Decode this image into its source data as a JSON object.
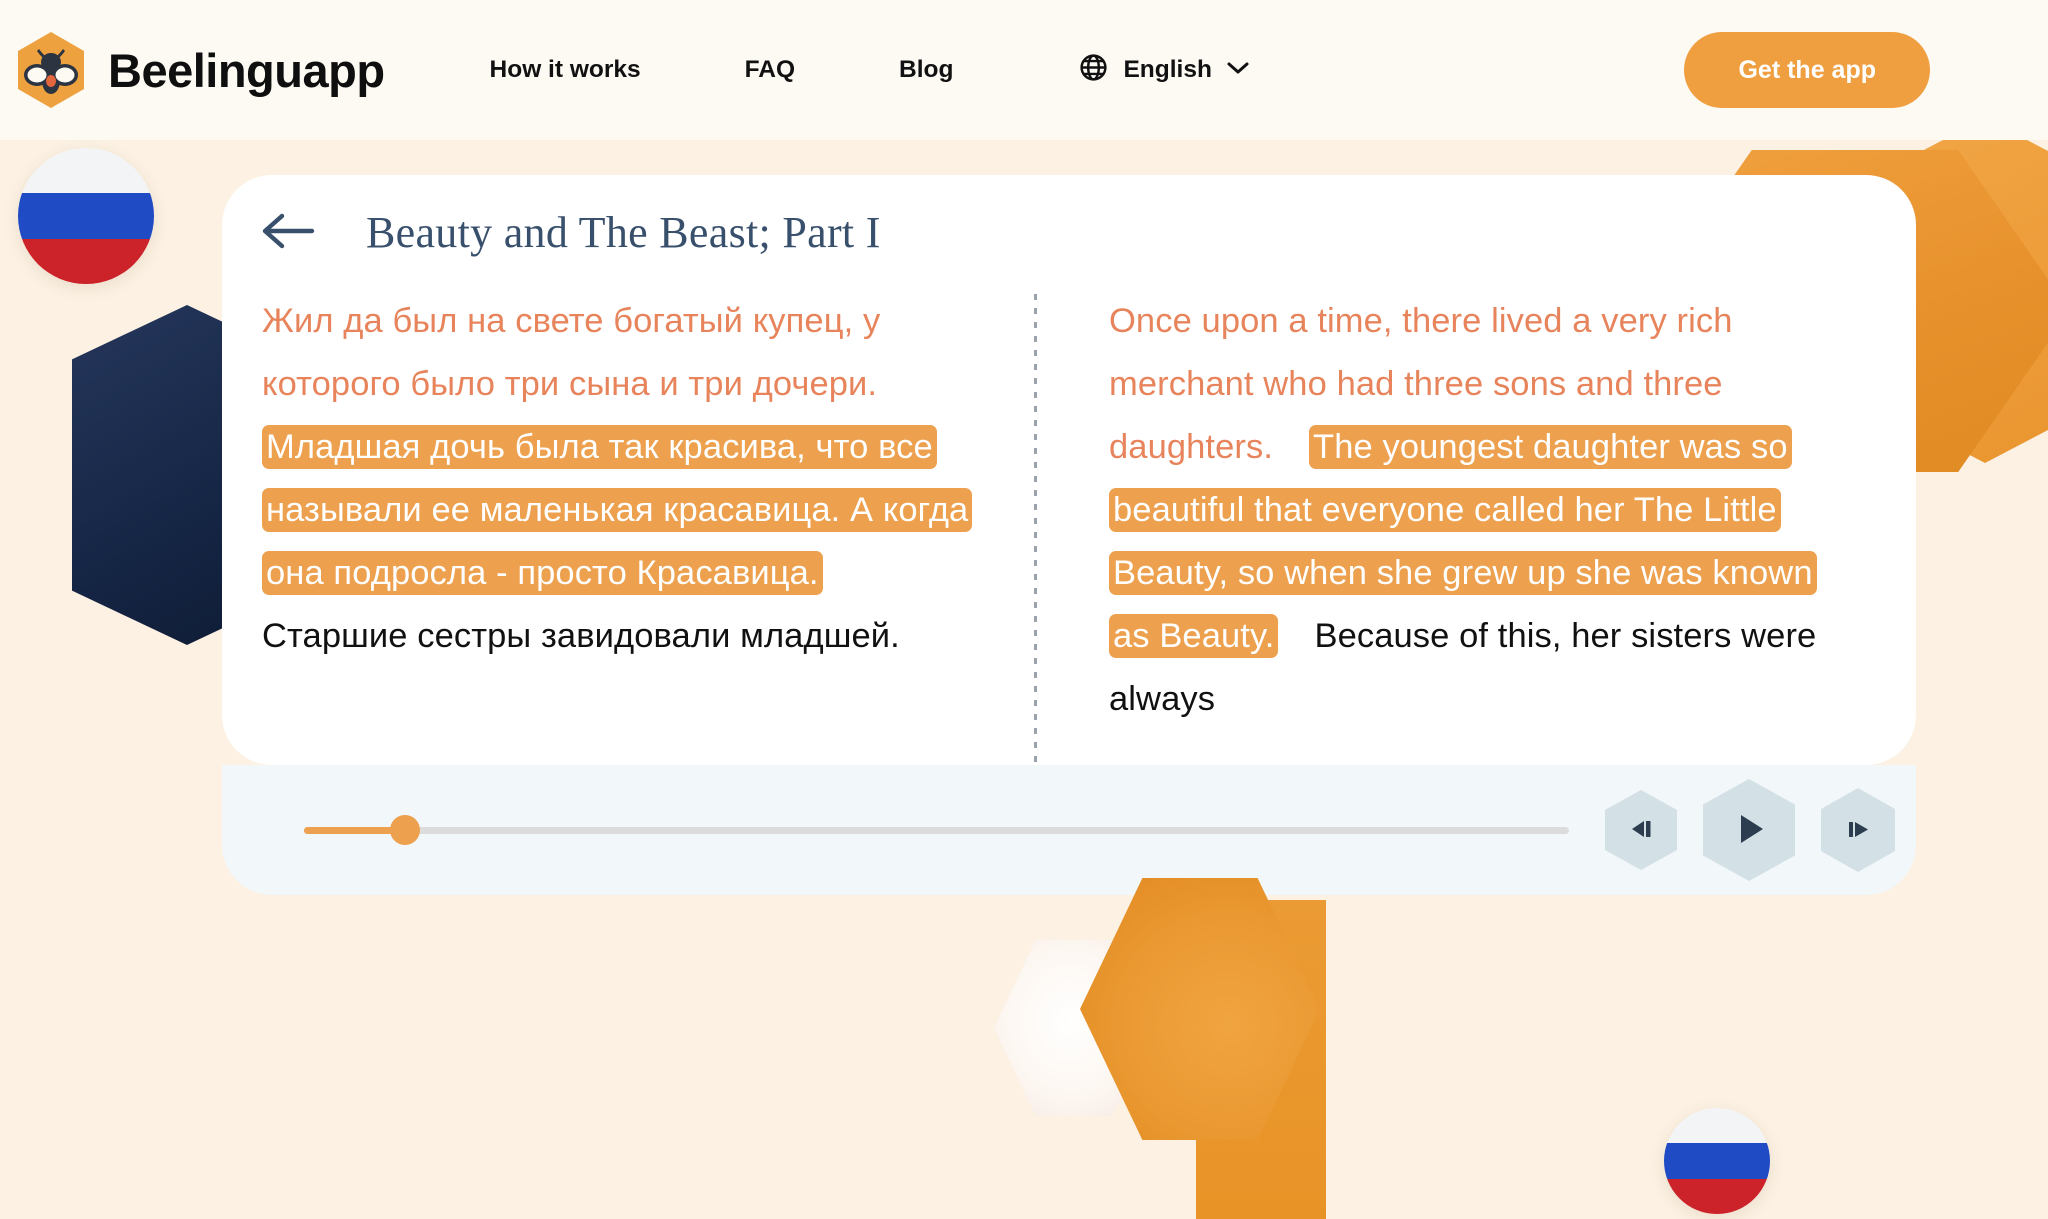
{
  "header": {
    "brand_name": "Beelinguapp",
    "logo_icon": "bee-hexagon-logo",
    "nav": [
      {
        "label": "How it works"
      },
      {
        "label": "FAQ"
      },
      {
        "label": "Blog"
      }
    ],
    "language_selector": {
      "icon": "globe-icon",
      "value": "English",
      "chevron_icon": "chevron-down-icon"
    },
    "cta": {
      "label": "Get the app"
    }
  },
  "reader": {
    "back_icon": "arrow-left-icon",
    "title": "Beauty and The Beast; Part I",
    "left_column": {
      "language": "Russian",
      "read_text": "Жил да был на свете богатый купец, у которого было три сына и три дочери.",
      "active_text": "Младшая дочь была так красива, что все называли ее маленькая красавица. А когда она подросла - просто Красавица.",
      "upcoming_text": "Старшие сестры завидовали младшей."
    },
    "right_column": {
      "language": "English",
      "read_text": "Once upon a time, there lived a very rich merchant who had three sons and three daughters.",
      "active_text": "The youngest daughter was so beautiful that everyone called her The Little Beauty, so when she grew up she was known as Beauty.",
      "upcoming_text": "Because of this, her sisters were always"
    }
  },
  "player": {
    "progress_percent": 8,
    "previous_icon": "skip-previous-icon",
    "play_icon": "play-icon",
    "next_icon": "skip-next-icon"
  },
  "decorations": {
    "flag_left": "russia-flag-circle",
    "flag_bottom_right": "russia-flag-circle",
    "navy_hexagon": "navy-hexagon-shape",
    "orange_hexagon_top_right": "orange-hexagon-shape",
    "orange_hexagon_bottom": "orange-hexagon-shape",
    "white_hexagon_bottom": "white-hexagon-shape"
  },
  "colors": {
    "brand_orange": "#ef9f3f",
    "highlight_orange": "#eda04d",
    "read_text_orange": "#e8845c",
    "title_navy": "#39506d",
    "page_bg": "#fdf9f2",
    "hero_bg": "#fcf1e3",
    "player_bg": "#f2f7f9",
    "hex_button_bg": "#d3e0e6"
  }
}
